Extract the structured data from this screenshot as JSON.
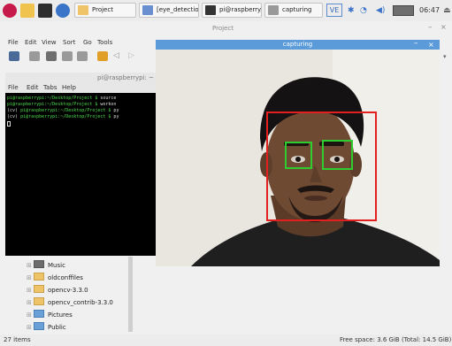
{
  "taskbar": {
    "windows": [
      {
        "label": "Project"
      },
      {
        "label": "[eye_detectio..."
      },
      {
        "label": "pi@raspberry..."
      },
      {
        "label": "capturing"
      }
    ],
    "tray": {
      "input_indicator": "VE",
      "clock": "06:47"
    }
  },
  "file_manager": {
    "title": "Project",
    "menu": [
      "File",
      "Edit",
      "View",
      "Sort",
      "Go",
      "Tools"
    ],
    "tree_items": [
      {
        "label": "Music",
        "icon": "music-folder-icon"
      },
      {
        "label": "oldconffiles",
        "icon": "folder-icon"
      },
      {
        "label": "opencv-3.3.0",
        "icon": "folder-icon"
      },
      {
        "label": "opencv_contrib-3.3.0",
        "icon": "folder-icon"
      },
      {
        "label": "Pictures",
        "icon": "pictures-folder-icon"
      },
      {
        "label": "Public",
        "icon": "public-folder-icon"
      }
    ],
    "status_left": "27 items",
    "status_right": "Free space: 3.6 GiB (Total: 14.5 GiB)"
  },
  "terminal": {
    "title": "pi@raspberrypi: ~",
    "menu": [
      "File",
      "Edit",
      "Tabs",
      "Help"
    ],
    "lines": [
      {
        "prefix": "",
        "prompt": "pi@raspberrypi:~/Desktop/Project $",
        "cmd": " source"
      },
      {
        "prefix": "",
        "prompt": "pi@raspberrypi:~/Desktop/Project $",
        "cmd": " workon"
      },
      {
        "prefix": "(cv) ",
        "prompt": "pi@raspberrypi:~/Desktop/Project $",
        "cmd": " py"
      },
      {
        "prefix": "(cv) ",
        "prompt": "pi@raspberrypi:~/Desktop/Project $",
        "cmd": " py"
      }
    ]
  },
  "capture_window": {
    "title": "capturing"
  },
  "colors": {
    "face_box": "#e32020",
    "eye_box": "#2fcc2f",
    "titlebar": "#5b9bd9"
  }
}
